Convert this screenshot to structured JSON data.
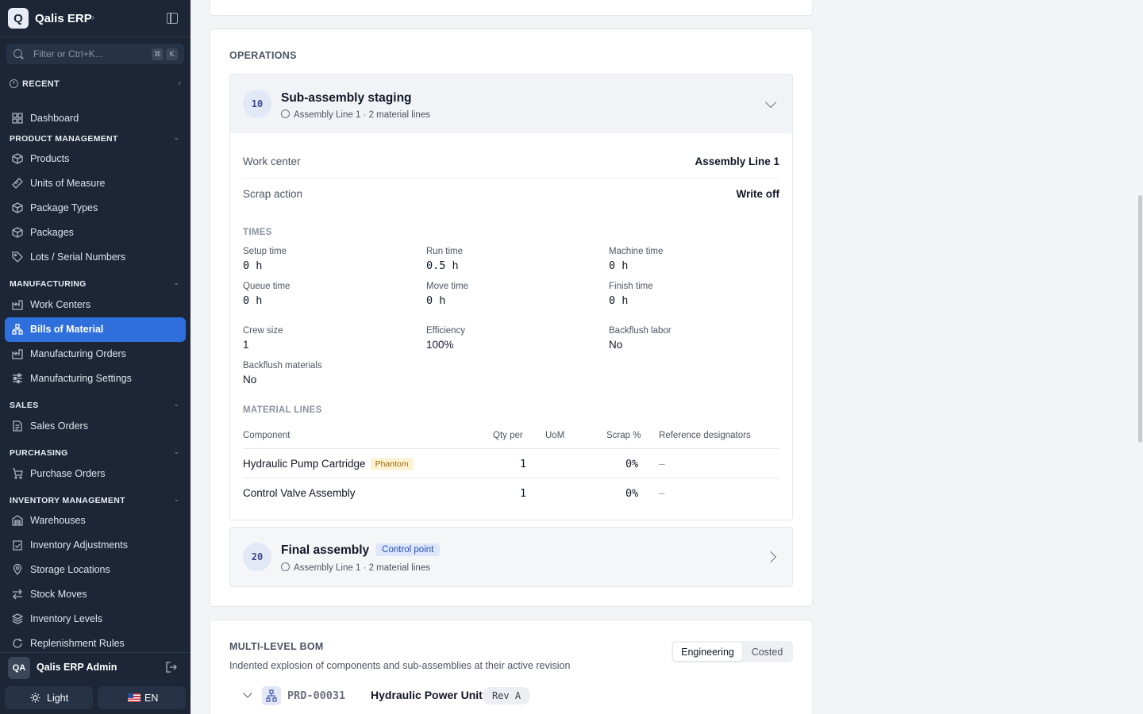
{
  "app": {
    "logo_letter": "Q",
    "name": "Qalis ERP",
    "name_chevron": "›"
  },
  "search": {
    "placeholder": "Filter or Ctrl+K...",
    "kbd_1": "⌘",
    "kbd_2": "K"
  },
  "recent": {
    "label": "RECENT"
  },
  "nav": {
    "dashboard": "Dashboard",
    "product_management": {
      "label": "PRODUCT MANAGEMENT",
      "items": [
        "Products",
        "Units of Measure",
        "Package Types",
        "Packages",
        "Lots / Serial Numbers"
      ]
    },
    "manufacturing": {
      "label": "MANUFACTURING",
      "items": [
        "Work Centers",
        "Bills of Material",
        "Manufacturing Orders",
        "Manufacturing Settings"
      ],
      "active": "Bills of Material"
    },
    "sales": {
      "label": "SALES",
      "items": [
        "Sales Orders"
      ]
    },
    "purchasing": {
      "label": "PURCHASING",
      "items": [
        "Purchase Orders"
      ]
    },
    "inventory_management": {
      "label": "INVENTORY MANAGEMENT",
      "items": [
        "Warehouses",
        "Inventory Adjustments",
        "Storage Locations",
        "Stock Moves",
        "Inventory Levels",
        "Replenishment Rules"
      ]
    }
  },
  "user": {
    "initials": "QA",
    "name": "Qalis ERP Admin"
  },
  "footer": {
    "theme_label": "Light",
    "language_label": "EN"
  },
  "operations": {
    "title": "OPERATIONS",
    "op1": {
      "number": "10",
      "title": "Sub-assembly staging",
      "subtitle": "Assembly Line 1 · 2 material lines",
      "work_center_label": "Work center",
      "work_center_value": "Assembly Line 1",
      "scrap_action_label": "Scrap action",
      "scrap_action_value": "Write off",
      "times_title": "TIMES",
      "setup_time_label": "Setup time",
      "setup_time_value": "0 h",
      "run_time_label": "Run time",
      "run_time_value": "0.5 h",
      "machine_time_label": "Machine time",
      "machine_time_value": "0 h",
      "queue_time_label": "Queue time",
      "queue_time_value": "0 h",
      "move_time_label": "Move time",
      "move_time_value": "0 h",
      "finish_time_label": "Finish time",
      "finish_time_value": "0 h",
      "crew_size_label": "Crew size",
      "crew_size_value": "1",
      "efficiency_label": "Efficiency",
      "efficiency_value": "100%",
      "backflush_labor_label": "Backflush labor",
      "backflush_labor_value": "No",
      "backflush_materials_label": "Backflush materials",
      "backflush_materials_value": "No",
      "material_lines_title": "MATERIAL LINES",
      "columns": {
        "component": "Component",
        "qty_per": "Qty per",
        "uom": "UoM",
        "scrap": "Scrap %",
        "ref": "Reference designators"
      },
      "rows": [
        {
          "component": "Hydraulic Pump Cartridge",
          "badge": "Phantom",
          "qty_per": "1",
          "uom": "",
          "scrap": "0%",
          "ref": "–"
        },
        {
          "component": "Control Valve Assembly",
          "badge": "",
          "qty_per": "1",
          "uom": "",
          "scrap": "0%",
          "ref": "–"
        }
      ]
    },
    "op2": {
      "number": "20",
      "title": "Final assembly",
      "badge": "Control point",
      "subtitle": "Assembly Line 1 · 2 material lines"
    }
  },
  "multi_level_bom": {
    "title": "MULTI-LEVEL BOM",
    "description": "Indented explosion of components and sub-assemblies at their active revision",
    "toggle": {
      "engineering": "Engineering",
      "costed": "Costed",
      "selected": "Engineering"
    },
    "root": {
      "code": "PRD-00031",
      "name": "Hydraulic Power Unit",
      "revision": "Rev A"
    }
  },
  "colors": {
    "sidebar_bg": "#1c2636",
    "active_nav": "#2f6fdc",
    "phantom_badge_bg": "#fdf3d4",
    "control_point_badge_bg": "#dde6fb"
  }
}
